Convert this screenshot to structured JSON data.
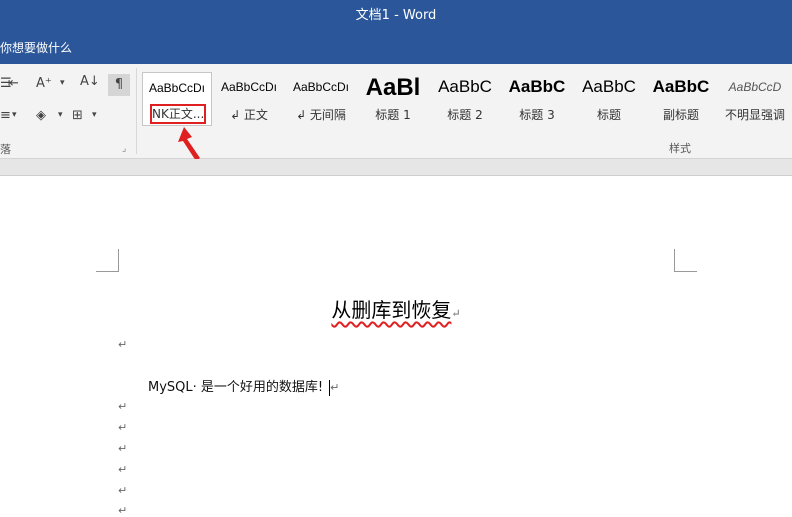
{
  "window": {
    "title": "文档1  -  Word"
  },
  "tellme": {
    "text": "你想要做什么"
  },
  "ribbon": {
    "paragraph_group_label": "落",
    "styles_group_label": "样式",
    "styles": [
      {
        "preview": "AaBbCcDı",
        "label": "NK正文...",
        "selected": true
      },
      {
        "preview": "AaBbCcDı",
        "label": "↲ 正文"
      },
      {
        "preview": "AaBbCcDı",
        "label": "↲ 无间隔"
      },
      {
        "preview": "AaBl",
        "label": "标题 1"
      },
      {
        "preview": "AaBbC",
        "label": "标题 2"
      },
      {
        "preview": "AaBbC",
        "label": "标题 3"
      },
      {
        "preview": "AaBbC",
        "label": "标题"
      },
      {
        "preview": "AaBbC",
        "label": "副标题"
      },
      {
        "preview": "AaBbCcD",
        "label": "不明显强调"
      }
    ]
  },
  "document": {
    "title": "从删库到恢复",
    "body_line": "MySQL· 是一个好用的数据库!",
    "paragraph_mark": "↵"
  },
  "colors": {
    "title_bar": "#2b579a",
    "highlight": "#e02020"
  }
}
